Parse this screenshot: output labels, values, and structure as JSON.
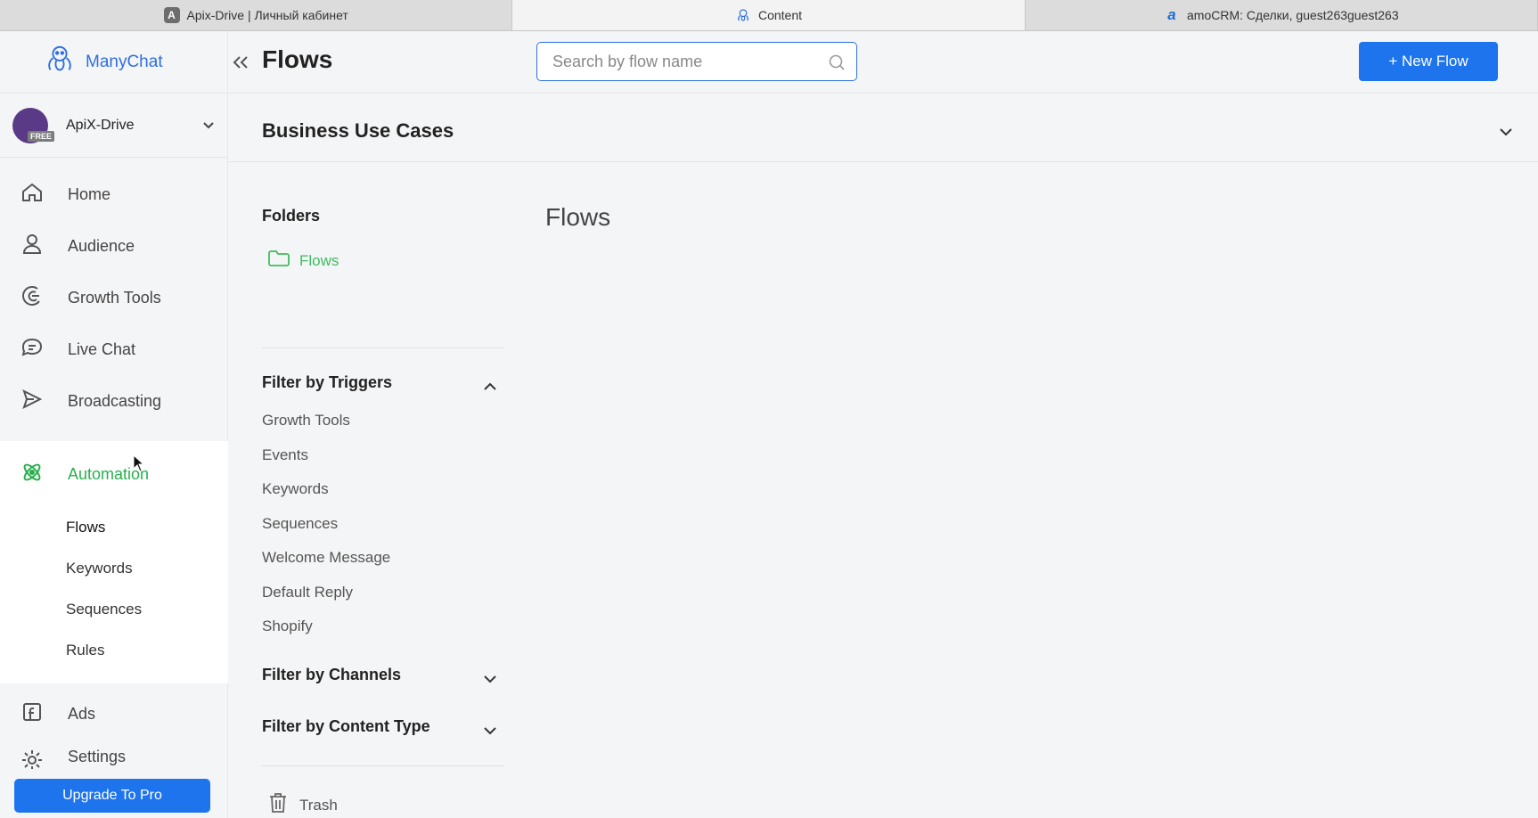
{
  "browser": {
    "tabs": [
      {
        "label": "Apix-Drive | Личный кабинет",
        "icon": "apix-drive-favicon",
        "active": false
      },
      {
        "label": "Content",
        "icon": "manychat-favicon",
        "active": true
      },
      {
        "label": "amoCRM: Сделки, guest263guest263",
        "icon": "amocrm-favicon",
        "active": false
      }
    ]
  },
  "brand": {
    "name": "ManyChat",
    "color": "#2f6fe0"
  },
  "account": {
    "name": "ApiX-Drive",
    "badge": "FREE"
  },
  "sidebar": {
    "items": [
      {
        "label": "Home",
        "icon": "home-icon"
      },
      {
        "label": "Audience",
        "icon": "user-icon"
      },
      {
        "label": "Growth Tools",
        "icon": "growth-tools-icon"
      },
      {
        "label": "Live Chat",
        "icon": "chat-bubble-icon"
      },
      {
        "label": "Broadcasting",
        "icon": "send-icon"
      }
    ],
    "automation": {
      "label": "Automation",
      "icon": "automation-icon",
      "color": "#27b04d",
      "sub": [
        "Flows",
        "Keywords",
        "Sequences",
        "Rules"
      ],
      "active_sub": "Flows"
    },
    "ads": {
      "label": "Ads",
      "icon": "facebook-ads-icon"
    },
    "settings": {
      "label": "Settings",
      "icon": "gear-icon"
    },
    "upgrade_label": "Upgrade To Pro"
  },
  "header": {
    "title": "Flows",
    "search_placeholder": "Search by flow name",
    "new_flow_label": "+ New Flow",
    "accent": "#1e74ec"
  },
  "business_use_cases": {
    "title": "Business Use Cases"
  },
  "filters": {
    "folders_title": "Folders",
    "folder_name": "Flows",
    "folder_color": "#3fbc5e",
    "triggers_title": "Filter by Triggers",
    "triggers": [
      "Growth Tools",
      "Events",
      "Keywords",
      "Sequences",
      "Welcome Message",
      "Default Reply",
      "Shopify"
    ],
    "channels_title": "Filter by Channels",
    "content_type_title": "Filter by Content Type",
    "trash_label": "Trash"
  },
  "content": {
    "title": "Flows"
  }
}
